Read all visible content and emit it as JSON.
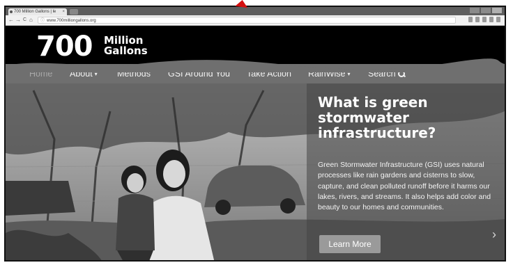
{
  "browser": {
    "tab_title": "700 Million Gallons | le",
    "tab_close": "×",
    "url": "www.700milliongallons.org",
    "back_glyph": "←",
    "forward_glyph": "→",
    "reload_glyph": "C",
    "home_glyph": "⌂",
    "info_glyph": "ⓘ"
  },
  "site": {
    "logo_number": "700",
    "logo_line1": "Million",
    "logo_line2": "Gallons"
  },
  "nav": {
    "items": [
      {
        "label": "Home"
      },
      {
        "label": "About"
      },
      {
        "label": "Methods"
      },
      {
        "label": "GSI Around You"
      },
      {
        "label": "Take Action"
      },
      {
        "label": "RainWise"
      },
      {
        "label": "Search"
      }
    ],
    "caret": "▾"
  },
  "hero": {
    "heading": "What is green stormwater infrastructure?",
    "body": "Green Stormwater Infrastructure (GSI) uses natural processes like rain gardens and cisterns to slow, capture, and clean polluted runoff before it harms our lakes, rivers, and streams. It also helps add color and beauty to our homes and communities.",
    "button_label": "Learn More",
    "next_glyph": "›"
  },
  "icons": [
    "favicon-icon",
    "close-icon",
    "back-arrow-icon",
    "forward-arrow-icon",
    "reload-icon",
    "home-icon",
    "info-icon",
    "search-icon",
    "chevron-down-icon",
    "next-slide-icon"
  ],
  "colors": {
    "header_bg": "#000000",
    "nav_bg": "#6f6f6f",
    "nav_active": "#a9a9a9",
    "annotation_arrow": "#d40f0f"
  }
}
